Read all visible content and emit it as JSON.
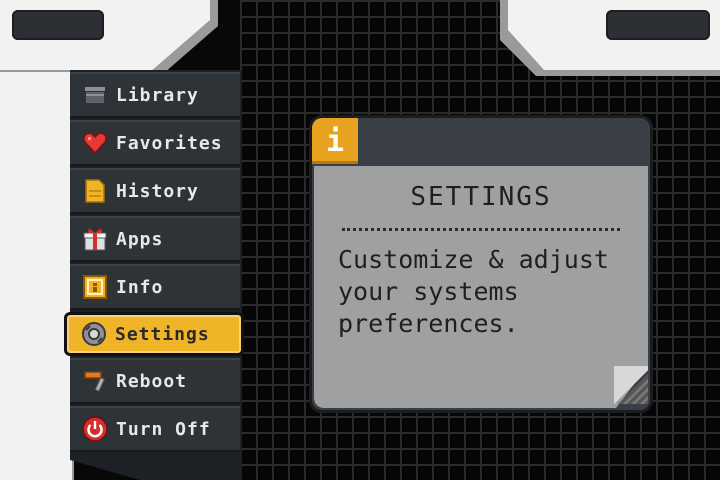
{
  "menu": {
    "items": [
      {
        "label": "Library",
        "icon": "library-icon"
      },
      {
        "label": "Favorites",
        "icon": "heart-icon"
      },
      {
        "label": "History",
        "icon": "history-icon"
      },
      {
        "label": "Apps",
        "icon": "gift-icon"
      },
      {
        "label": "Info",
        "icon": "info-icon"
      },
      {
        "label": "Settings",
        "icon": "gear-icon",
        "selected": true
      },
      {
        "label": "Reboot",
        "icon": "hammer-icon"
      },
      {
        "label": "Turn Off",
        "icon": "power-icon"
      }
    ]
  },
  "dialog": {
    "badge": "i",
    "title": "SETTINGS",
    "text": "Customize & adjust\nyour systems\npreferences."
  },
  "colors": {
    "accent": "#f0b429",
    "badge": "#e9a21f",
    "sidebar": "#2e3338",
    "panel": "#9ea0a2"
  }
}
